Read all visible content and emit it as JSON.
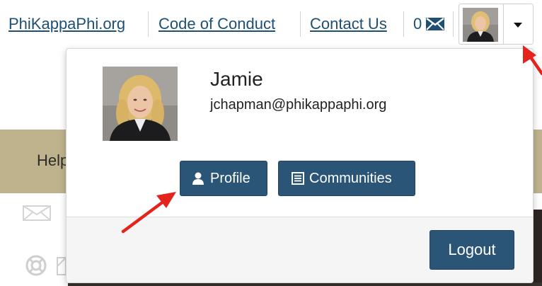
{
  "topnav": {
    "links": {
      "site": "PhiKappaPhi.org",
      "conduct": "Code of Conduct",
      "contact": "Contact Us"
    },
    "message_count": "0",
    "message_icon": "envelope-icon",
    "toggle_icon": "caret-down-icon"
  },
  "background": {
    "banner_text": "Help",
    "banner_color": "#bfb38e"
  },
  "user_menu": {
    "name": "Jamie",
    "email": "jchapman@phikappaphi.org",
    "buttons": {
      "profile": "Profile",
      "communities": "Communities",
      "logout": "Logout"
    },
    "button_color": "#2b5577"
  },
  "annotations": {
    "arrow_color": "#e3231c",
    "arrow_count": 2
  }
}
